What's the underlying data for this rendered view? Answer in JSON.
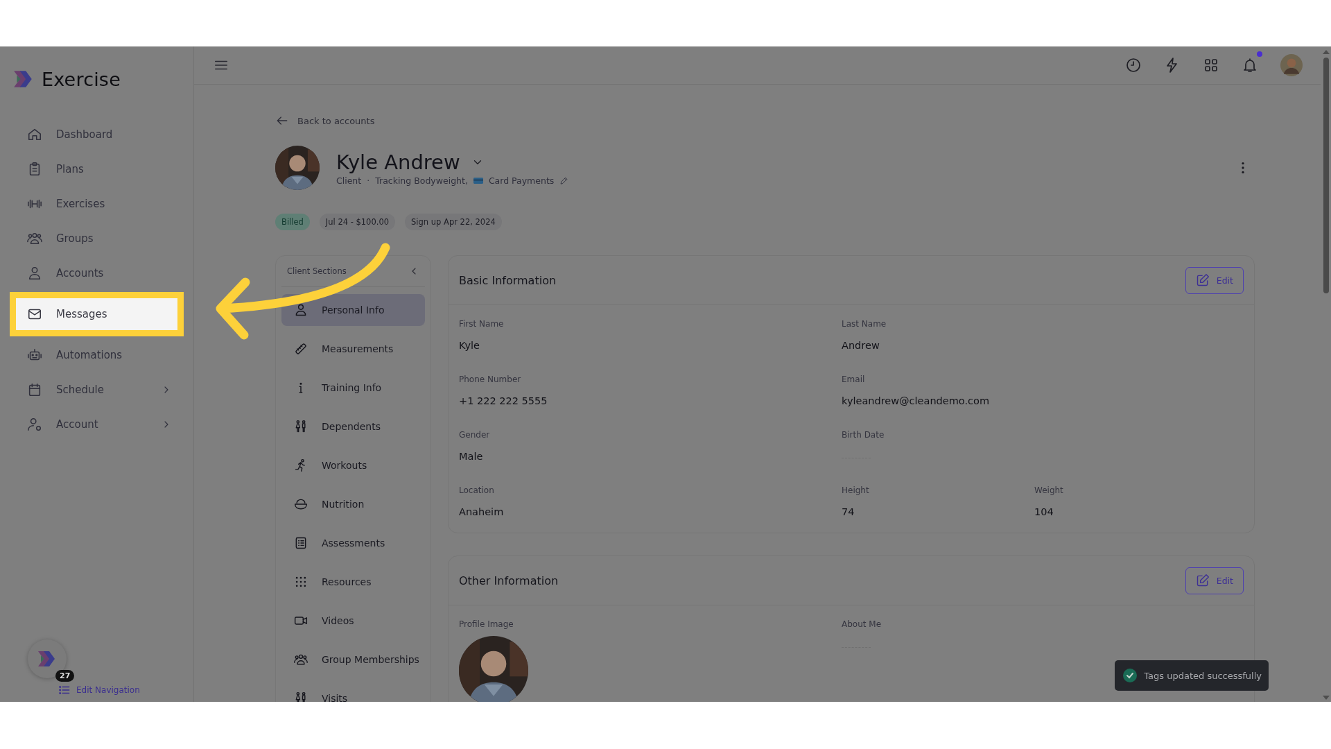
{
  "app": {
    "name": "Exercise",
    "badge": "27",
    "edit_navigation": "Edit Navigation"
  },
  "sidebar": {
    "items": [
      {
        "label": "Dashboard",
        "highlighted": false,
        "expandable": false
      },
      {
        "label": "Plans",
        "highlighted": false,
        "expandable": false
      },
      {
        "label": "Exercises",
        "highlighted": false,
        "expandable": false
      },
      {
        "label": "Groups",
        "highlighted": false,
        "expandable": false
      },
      {
        "label": "Accounts",
        "highlighted": false,
        "expandable": false
      },
      {
        "label": "Messages",
        "highlighted": true,
        "expandable": false
      },
      {
        "label": "Automations",
        "highlighted": false,
        "expandable": false
      },
      {
        "label": "Schedule",
        "highlighted": false,
        "expandable": true
      },
      {
        "label": "Account",
        "highlighted": false,
        "expandable": true
      }
    ]
  },
  "header": {
    "notifications_unread": true
  },
  "profile": {
    "back_link": "Back to accounts",
    "name": "Kyle Andrew",
    "role": "Client",
    "separator": "·",
    "tracking": "Tracking Bodyweight,",
    "payment": "Card Payments",
    "badges": [
      {
        "label": "Billed",
        "kind": "status"
      },
      {
        "label": "Jul 24 - $100.00",
        "kind": "plain"
      },
      {
        "label": "Sign up Apr 22, 2024",
        "kind": "plain"
      }
    ]
  },
  "client_sections": {
    "title": "Client Sections",
    "items": [
      {
        "label": "Personal Info",
        "selected": true
      },
      {
        "label": "Measurements",
        "selected": false
      },
      {
        "label": "Training Info",
        "selected": false
      },
      {
        "label": "Dependents",
        "selected": false
      },
      {
        "label": "Workouts",
        "selected": false
      },
      {
        "label": "Nutrition",
        "selected": false
      },
      {
        "label": "Assessments",
        "selected": false
      },
      {
        "label": "Resources",
        "selected": false
      },
      {
        "label": "Videos",
        "selected": false
      },
      {
        "label": "Group Memberships",
        "selected": false
      },
      {
        "label": "Visits",
        "selected": false
      }
    ]
  },
  "basic_information": {
    "title": "Basic Information",
    "edit": "Edit",
    "rows": [
      [
        {
          "label": "First Name",
          "value": "Kyle"
        },
        {
          "label": "Last Name",
          "value": "Andrew"
        }
      ],
      [
        {
          "label": "Phone Number",
          "value": "+1 222 222 5555"
        },
        {
          "label": "Email",
          "value": "kyleandrew@cleandemo.com"
        }
      ],
      [
        {
          "label": "Gender",
          "value": "Male"
        },
        {
          "label": "Birth Date",
          "empty": true
        }
      ],
      [
        {
          "label": "Location",
          "value": "Anaheim"
        },
        {
          "label": "Height",
          "value": "74"
        },
        {
          "label": "Weight",
          "value": "104"
        }
      ]
    ]
  },
  "other_information": {
    "title": "Other Information",
    "edit": "Edit",
    "fields": [
      {
        "label": "Profile Image",
        "kind": "picture"
      },
      {
        "label": "About Me",
        "kind": "empty"
      }
    ]
  },
  "toast": {
    "message": "Tags updated successfully"
  }
}
